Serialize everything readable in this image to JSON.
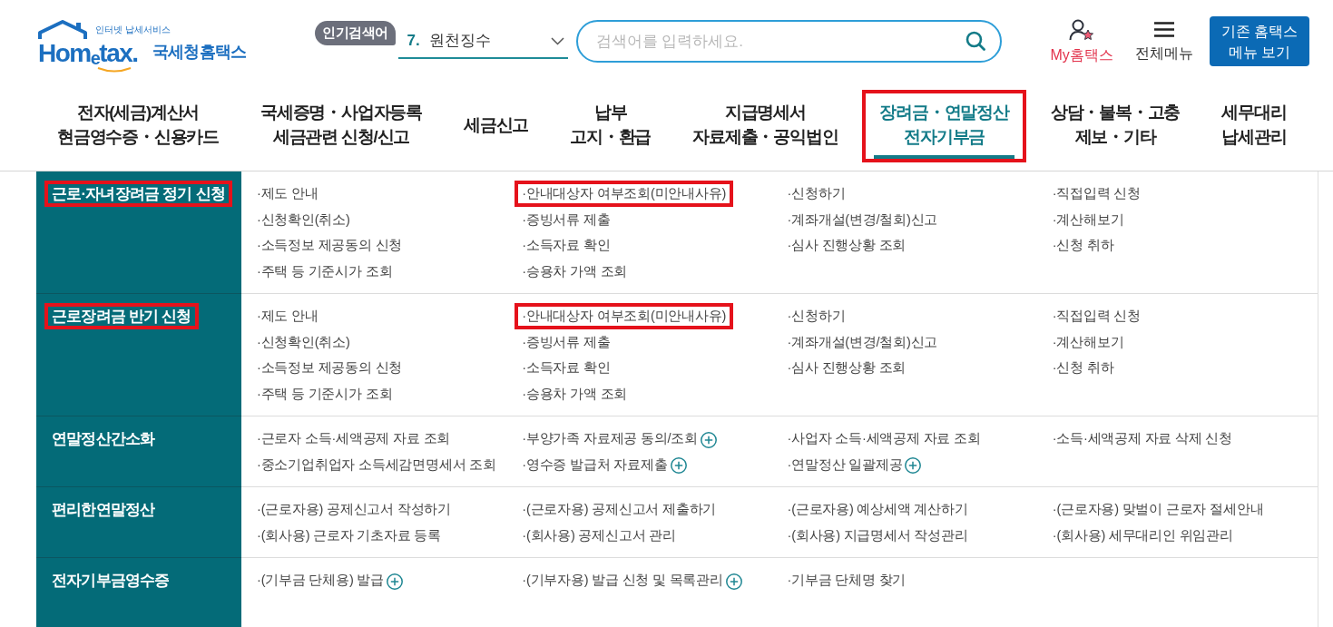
{
  "header": {
    "logo": {
      "tagline": "인터넷 납세서비스",
      "wordmark": "Hom$_{e}$tax.",
      "name": "국세청홈택스"
    },
    "popular_search": {
      "label": "인기검색어",
      "rank": "7.",
      "term": "원천징수"
    },
    "search": {
      "placeholder": "검색어를 입력하세요."
    },
    "my_hometax": {
      "label": "My홈택스"
    },
    "all_menu": {
      "label": "전체메뉴"
    },
    "legacy_button": {
      "label": "기존 홈택스 메뉴 보기"
    }
  },
  "nav": [
    {
      "lines": [
        "전자(세금)계산서",
        "현금영수증・신용카드"
      ],
      "selected": false,
      "highlighted": false
    },
    {
      "lines": [
        "국세증명・사업자등록",
        "세금관련 신청/신고"
      ],
      "selected": false,
      "highlighted": false
    },
    {
      "lines": [
        "세금신고"
      ],
      "selected": false,
      "highlighted": false
    },
    {
      "lines": [
        "납부",
        "고지・환급"
      ],
      "selected": false,
      "highlighted": false
    },
    {
      "lines": [
        "지급명세서",
        "자료제출・공익법인"
      ],
      "selected": false,
      "highlighted": false
    },
    {
      "lines": [
        "장려금・연말정산",
        "전자기부금"
      ],
      "selected": true,
      "highlighted": true
    },
    {
      "lines": [
        "상담・불복・고충",
        "제보・기타"
      ],
      "selected": false,
      "highlighted": false
    },
    {
      "lines": [
        "세무대리",
        "납세관리"
      ],
      "selected": false,
      "highlighted": false
    }
  ],
  "sections": [
    {
      "title": "근로·자녀장려금 정기 신청",
      "highlighted": true,
      "links": [
        {
          "text": "·제도 안내",
          "plus": false,
          "highlighted": false
        },
        {
          "text": "·안내대상자 여부조회(미안내사유)",
          "plus": false,
          "highlighted": true
        },
        {
          "text": "·신청하기",
          "plus": false,
          "highlighted": false
        },
        {
          "text": "·직접입력 신청",
          "plus": false,
          "highlighted": false
        },
        {
          "text": "·신청확인(취소)",
          "plus": false,
          "highlighted": false
        },
        {
          "text": "·증빙서류 제출",
          "plus": false,
          "highlighted": false
        },
        {
          "text": "·계좌개설(변경/철회)신고",
          "plus": false,
          "highlighted": false
        },
        {
          "text": "·계산해보기",
          "plus": false,
          "highlighted": false
        },
        {
          "text": "·소득정보 제공동의 신청",
          "plus": false,
          "highlighted": false
        },
        {
          "text": "·소득자료 확인",
          "plus": false,
          "highlighted": false
        },
        {
          "text": "·심사 진행상황 조회",
          "plus": false,
          "highlighted": false
        },
        {
          "text": "·신청 취하",
          "plus": false,
          "highlighted": false
        },
        {
          "text": "·주택 등 기준시가 조회",
          "plus": false,
          "highlighted": false
        },
        {
          "text": "·승용차 가액 조회",
          "plus": false,
          "highlighted": false
        }
      ]
    },
    {
      "title": "근로장려금 반기 신청",
      "highlighted": true,
      "links": [
        {
          "text": "·제도 안내",
          "plus": false,
          "highlighted": false
        },
        {
          "text": "·안내대상자 여부조회(미안내사유)",
          "plus": false,
          "highlighted": true
        },
        {
          "text": "·신청하기",
          "plus": false,
          "highlighted": false
        },
        {
          "text": "·직접입력 신청",
          "plus": false,
          "highlighted": false
        },
        {
          "text": "·신청확인(취소)",
          "plus": false,
          "highlighted": false
        },
        {
          "text": "·증빙서류 제출",
          "plus": false,
          "highlighted": false
        },
        {
          "text": "·계좌개설(변경/철회)신고",
          "plus": false,
          "highlighted": false
        },
        {
          "text": "·계산해보기",
          "plus": false,
          "highlighted": false
        },
        {
          "text": "·소득정보 제공동의 신청",
          "plus": false,
          "highlighted": false
        },
        {
          "text": "·소득자료 확인",
          "plus": false,
          "highlighted": false
        },
        {
          "text": "·심사 진행상황 조회",
          "plus": false,
          "highlighted": false
        },
        {
          "text": "·신청 취하",
          "plus": false,
          "highlighted": false
        },
        {
          "text": "·주택 등 기준시가 조회",
          "plus": false,
          "highlighted": false
        },
        {
          "text": "·승용차 가액 조회",
          "plus": false,
          "highlighted": false
        }
      ]
    },
    {
      "title": "연말정산간소화",
      "highlighted": false,
      "links": [
        {
          "text": "·근로자 소득·세액공제 자료 조회",
          "plus": false,
          "highlighted": false
        },
        {
          "text": "·부양가족 자료제공 동의/조회",
          "plus": true,
          "highlighted": false
        },
        {
          "text": "·사업자 소득·세액공제 자료 조회",
          "plus": false,
          "highlighted": false
        },
        {
          "text": "·소득·세액공제 자료 삭제 신청",
          "plus": false,
          "highlighted": false
        },
        {
          "text": "·중소기업취업자 소득세감면명세서 조회",
          "plus": false,
          "highlighted": false
        },
        {
          "text": "·영수증 발급처 자료제출",
          "plus": true,
          "highlighted": false
        },
        {
          "text": "·연말정산 일괄제공",
          "plus": true,
          "highlighted": false
        }
      ]
    },
    {
      "title": "편리한연말정산",
      "highlighted": false,
      "links": [
        {
          "text": "·(근로자용) 공제신고서 작성하기",
          "plus": false,
          "highlighted": false
        },
        {
          "text": "·(근로자용) 공제신고서 제출하기",
          "plus": false,
          "highlighted": false
        },
        {
          "text": "·(근로자용) 예상세액 계산하기",
          "plus": false,
          "highlighted": false
        },
        {
          "text": "·(근로자용) 맞벌이 근로자 절세안내",
          "plus": false,
          "highlighted": false
        },
        {
          "text": "·(회사용) 근로자 기초자료 등록",
          "plus": false,
          "highlighted": false
        },
        {
          "text": "·(회사용) 공제신고서 관리",
          "plus": false,
          "highlighted": false
        },
        {
          "text": "·(회사용) 지급명세서 작성관리",
          "plus": false,
          "highlighted": false
        },
        {
          "text": "·(회사용) 세무대리인 위임관리",
          "plus": false,
          "highlighted": false
        }
      ]
    },
    {
      "title": "전자기부금영수증",
      "highlighted": false,
      "links": [
        {
          "text": "·(기부금 단체용) 발급",
          "plus": true,
          "highlighted": false
        },
        {
          "text": "·(기부자용) 발급 신청 및 목록관리",
          "plus": true,
          "highlighted": false
        },
        {
          "text": "·기부금 단체명 찾기",
          "plus": false,
          "highlighted": false
        }
      ]
    }
  ]
}
